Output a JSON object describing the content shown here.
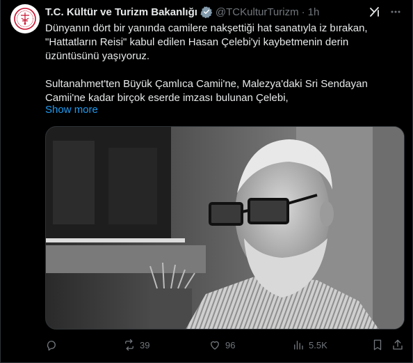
{
  "author": {
    "display_name": "T.C. Kültür ve Turizm Bakanlığı",
    "handle": "@TCKulturTurizm",
    "separator": "·",
    "time": "1h"
  },
  "tweet": {
    "paragraphs": [
      "Dünyanın dört bir yanında camilere nakşettiği hat sanatıyla iz bırakan, \"Hattatların Reisi\" kabul edilen Hasan Çelebi'yi kaybetmenin derin üzüntüsünü yaşıyoruz.",
      "Sultanahmet'ten Büyük Çamlıca Camii'ne, Malezya'daki Sri Sendayan Camii'ne kadar birçok eserde imzası bulunan Çelebi,"
    ],
    "show_more": "Show more"
  },
  "actions": {
    "reply_count": "",
    "retweet_count": "39",
    "like_count": "96",
    "views_count": "5.5K"
  },
  "colors": {
    "background": "#000000",
    "text": "#e7e9ea",
    "muted": "#71767b",
    "accent": "#1d9bf0",
    "border": "#2f3336",
    "logo_red": "#c8102e"
  },
  "icons": {
    "avatar": "ministry-logo",
    "verified": "verified-badge-icon",
    "grok": "grok-icon",
    "more": "more-options-icon",
    "reply": "reply-icon",
    "retweet": "retweet-icon",
    "like": "heart-icon",
    "views": "views-chart-icon",
    "bookmark": "bookmark-icon",
    "share": "share-icon"
  }
}
